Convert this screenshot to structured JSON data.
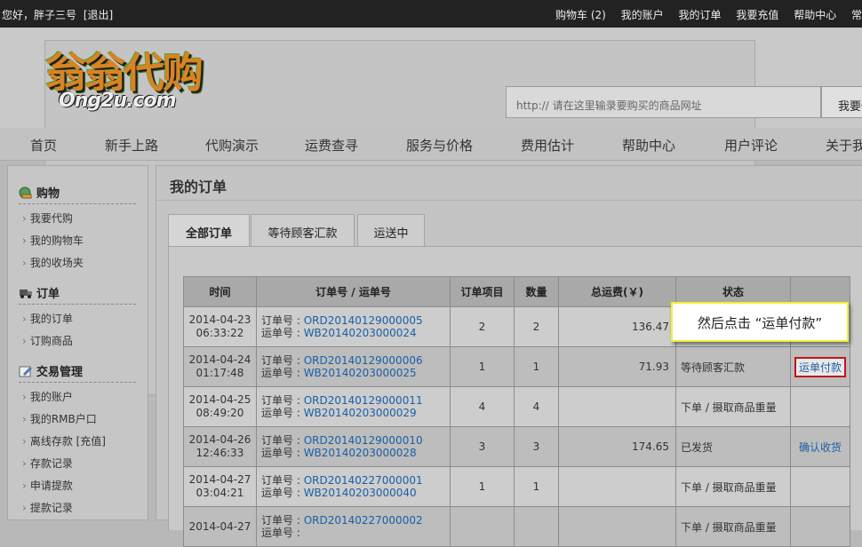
{
  "topbar": {
    "greeting": "您好，胖子三号",
    "logout": "[退出]",
    "links": [
      "购物车 (2)",
      "我的账户",
      "我的订单",
      "我要充值",
      "帮助中心",
      "常用"
    ]
  },
  "header": {
    "logo_main": "翁翁代购",
    "logo_sub": "Ong2u.com",
    "search_placeholder": "http:// 请在这里输录要购买的商品网址",
    "search_button": "我要代购"
  },
  "nav": [
    "首页",
    "新手上路",
    "代购演示",
    "运费查寻",
    "服务与价格",
    "费用估计",
    "帮助中心",
    "用户评论",
    "关于我们"
  ],
  "sidebar": {
    "sections": [
      {
        "title": "购物",
        "icon": "shopping-icon",
        "items": [
          "我要代购",
          "我的购物车",
          "我的收场夹"
        ]
      },
      {
        "title": "订单",
        "icon": "truck-icon",
        "items": [
          "我的订单",
          "订购商品"
        ]
      },
      {
        "title": "交易管理",
        "icon": "edit-icon",
        "items": [
          "我的账户",
          "我的RMB户口",
          "离线存款 [充值]",
          "存款记录",
          "申请提款",
          "提款记录"
        ]
      }
    ]
  },
  "main": {
    "title": "我的订单",
    "tabs": [
      "全部订单",
      "等待顾客汇款",
      "运送中"
    ],
    "table": {
      "headers": [
        "时间",
        "订单号 / 运单号",
        "订单项目",
        "数量",
        "总运费(￥)",
        "状态",
        ""
      ],
      "order_label": "订单号 : ",
      "waybill_label": "运单号 : ",
      "rows": [
        {
          "date": "2014-04-23",
          "time": "06:33:22",
          "order": "ORD20140129000005",
          "waybill": "WB20140203000024",
          "items": "2",
          "qty": "2",
          "fee": "136.47",
          "status": "",
          "action": ""
        },
        {
          "date": "2014-04-24",
          "time": "01:17:48",
          "order": "ORD20140129000006",
          "waybill": "WB20140203000025",
          "items": "1",
          "qty": "1",
          "fee": "71.93",
          "status": "等待顾客汇款",
          "action": "运单付款"
        },
        {
          "date": "2014-04-25",
          "time": "08:49:20",
          "order": "ORD20140129000011",
          "waybill": "WB20140203000029",
          "items": "4",
          "qty": "4",
          "fee": "",
          "status": "下单 / 摄取商品重量",
          "action": ""
        },
        {
          "date": "2014-04-26",
          "time": "12:46:33",
          "order": "ORD20140129000010",
          "waybill": "WB20140203000028",
          "items": "3",
          "qty": "3",
          "fee": "174.65",
          "status": "已发货",
          "action": "确认收货"
        },
        {
          "date": "2014-04-27",
          "time": "03:04:21",
          "order": "ORD20140227000001",
          "waybill": "WB20140203000040",
          "items": "1",
          "qty": "1",
          "fee": "",
          "status": "下单 / 摄取商品重量",
          "action": ""
        },
        {
          "date": "2014-04-27",
          "time": "",
          "order": "ORD20140227000002",
          "waybill": "",
          "items": "",
          "qty": "",
          "fee": "",
          "status": "下单 / 摄取商品重量",
          "action": ""
        }
      ]
    }
  },
  "callout": "然后点击 “运单付款”",
  "colors": {
    "link": "#1b5fa5",
    "highlight_border": "#c0151a",
    "callout_border": "#f2ee3a"
  }
}
